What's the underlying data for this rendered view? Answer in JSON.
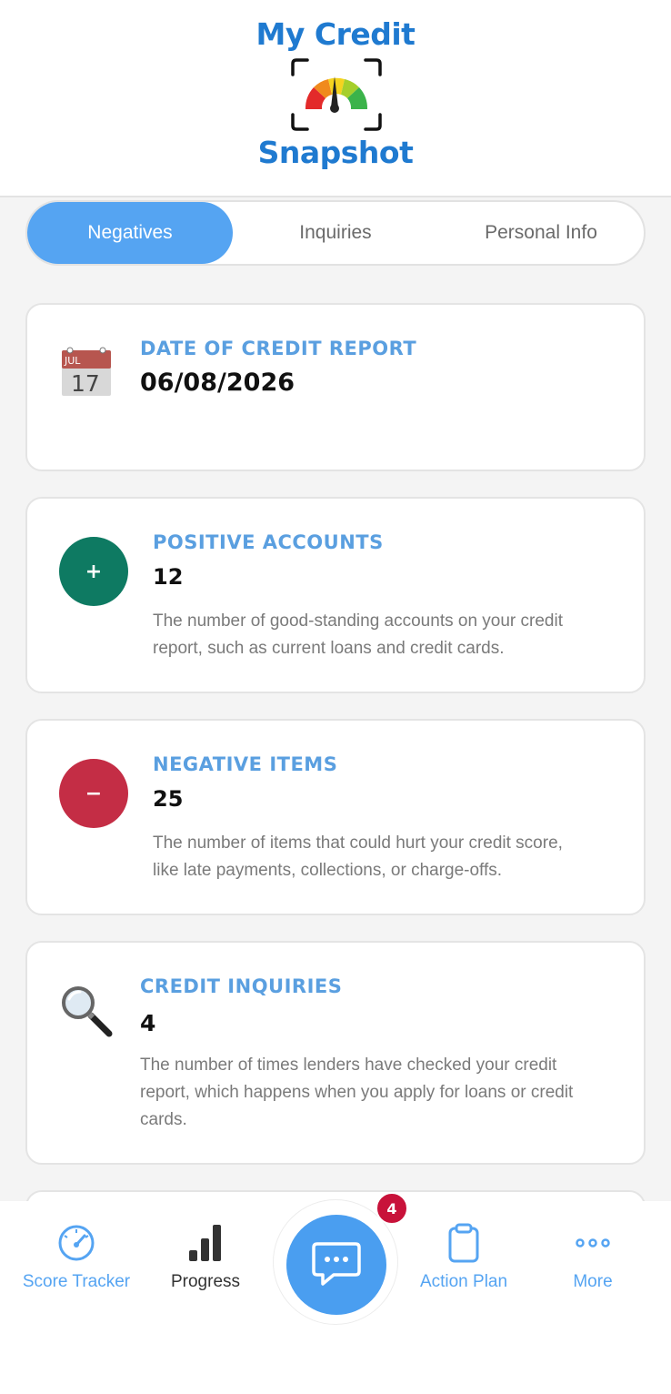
{
  "header": {
    "logo_line1": "My Credit",
    "logo_line2": "Snapshot"
  },
  "tabs": [
    {
      "label": "Negatives",
      "active": true
    },
    {
      "label": "Inquiries",
      "active": false
    },
    {
      "label": "Personal Info",
      "active": false
    }
  ],
  "cards": {
    "date": {
      "icon": "calendar-icon",
      "calendar_month": "JUL",
      "calendar_day": "17",
      "title": "DATE OF CREDIT REPORT",
      "value": "06/08/2026"
    },
    "positive": {
      "icon": "plus-icon",
      "symbol": "+",
      "color": "#0e7a62",
      "title": "POSITIVE ACCOUNTS",
      "value": "12",
      "desc_line1": "The number of good-standing accounts on your credit",
      "desc_line2": "report, such as current loans and credit cards."
    },
    "negative": {
      "icon": "minus-icon",
      "symbol": "−",
      "color": "#c42d45",
      "title": "NEGATIVE ITEMS",
      "value": "25",
      "desc_line1": "The number of items that could hurt your credit score,",
      "desc_line2": "like late payments, collections, or charge-offs."
    },
    "inquiries": {
      "icon": "magnifier-icon",
      "title": "CREDIT INQUIRIES",
      "value": "4",
      "desc_line1": "The number of times lenders have checked your credit",
      "desc_line2": "report, which happens when you apply for loans or credit",
      "desc_line3": "cards."
    }
  },
  "bottom_nav": {
    "score_tracker": "Score Tracker",
    "progress": "Progress",
    "action_plan": "Action Plan",
    "more": "More",
    "chat_badge": "4"
  },
  "colors": {
    "accent": "#55a4f2",
    "brand": "#1f7ad0",
    "badge": "#c8123a"
  }
}
